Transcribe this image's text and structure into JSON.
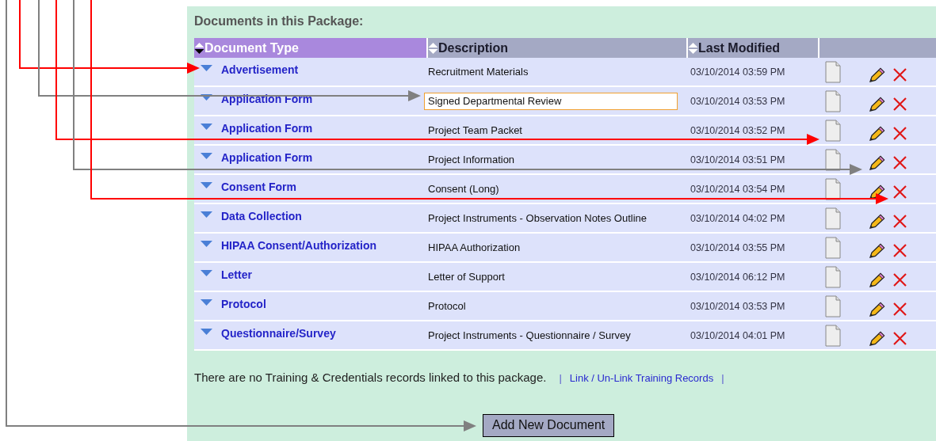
{
  "section_title": "Documents in this Package:",
  "table": {
    "columns": [
      {
        "label": "Document Type",
        "sorted": true
      },
      {
        "label": "Description",
        "sorted": false
      },
      {
        "label": "Last Modified",
        "sorted": false
      }
    ],
    "rows": [
      {
        "document_type": "Advertisement",
        "description": "Recruitment Materials",
        "editing": false,
        "last_modified": "03/10/2014 03:59 PM"
      },
      {
        "document_type": "Application Form",
        "description": "Signed Departmental Review",
        "editing": true,
        "last_modified": "03/10/2014 03:53 PM"
      },
      {
        "document_type": "Application Form",
        "description": "Project Team Packet",
        "editing": false,
        "last_modified": "03/10/2014 03:52 PM"
      },
      {
        "document_type": "Application Form",
        "description": "Project Information",
        "editing": false,
        "last_modified": "03/10/2014 03:51 PM"
      },
      {
        "document_type": "Consent Form",
        "description": "Consent (Long)",
        "editing": false,
        "last_modified": "03/10/2014 03:54 PM"
      },
      {
        "document_type": "Data Collection",
        "description": "Project Instruments - Observation Notes Outline",
        "editing": false,
        "last_modified": "03/10/2014 04:02 PM"
      },
      {
        "document_type": "HIPAA Consent/Authorization",
        "description": "HIPAA Authorization",
        "editing": false,
        "last_modified": "03/10/2014 03:55 PM"
      },
      {
        "document_type": "Letter",
        "description": "Letter of Support",
        "editing": false,
        "last_modified": "03/10/2014 06:12 PM"
      },
      {
        "document_type": "Protocol",
        "description": "Protocol",
        "editing": false,
        "last_modified": "03/10/2014 03:53 PM"
      },
      {
        "document_type": "Questionnaire/Survey",
        "description": "Project Instruments - Questionnaire / Survey",
        "editing": false,
        "last_modified": "03/10/2014 04:01 PM"
      }
    ]
  },
  "training_note": "There are no Training & Credentials records linked to this package.",
  "separators": [
    "|",
    "|"
  ],
  "training_link": "Link / Un-Link Training Records",
  "add_button": "Add New Document",
  "callout_arrows": [
    {
      "color": "#ff0000"
    },
    {
      "color": "#808080"
    },
    {
      "color": "#ff0000"
    },
    {
      "color": "#808080"
    },
    {
      "color": "#ff0000"
    },
    {
      "color": "#808080"
    }
  ]
}
